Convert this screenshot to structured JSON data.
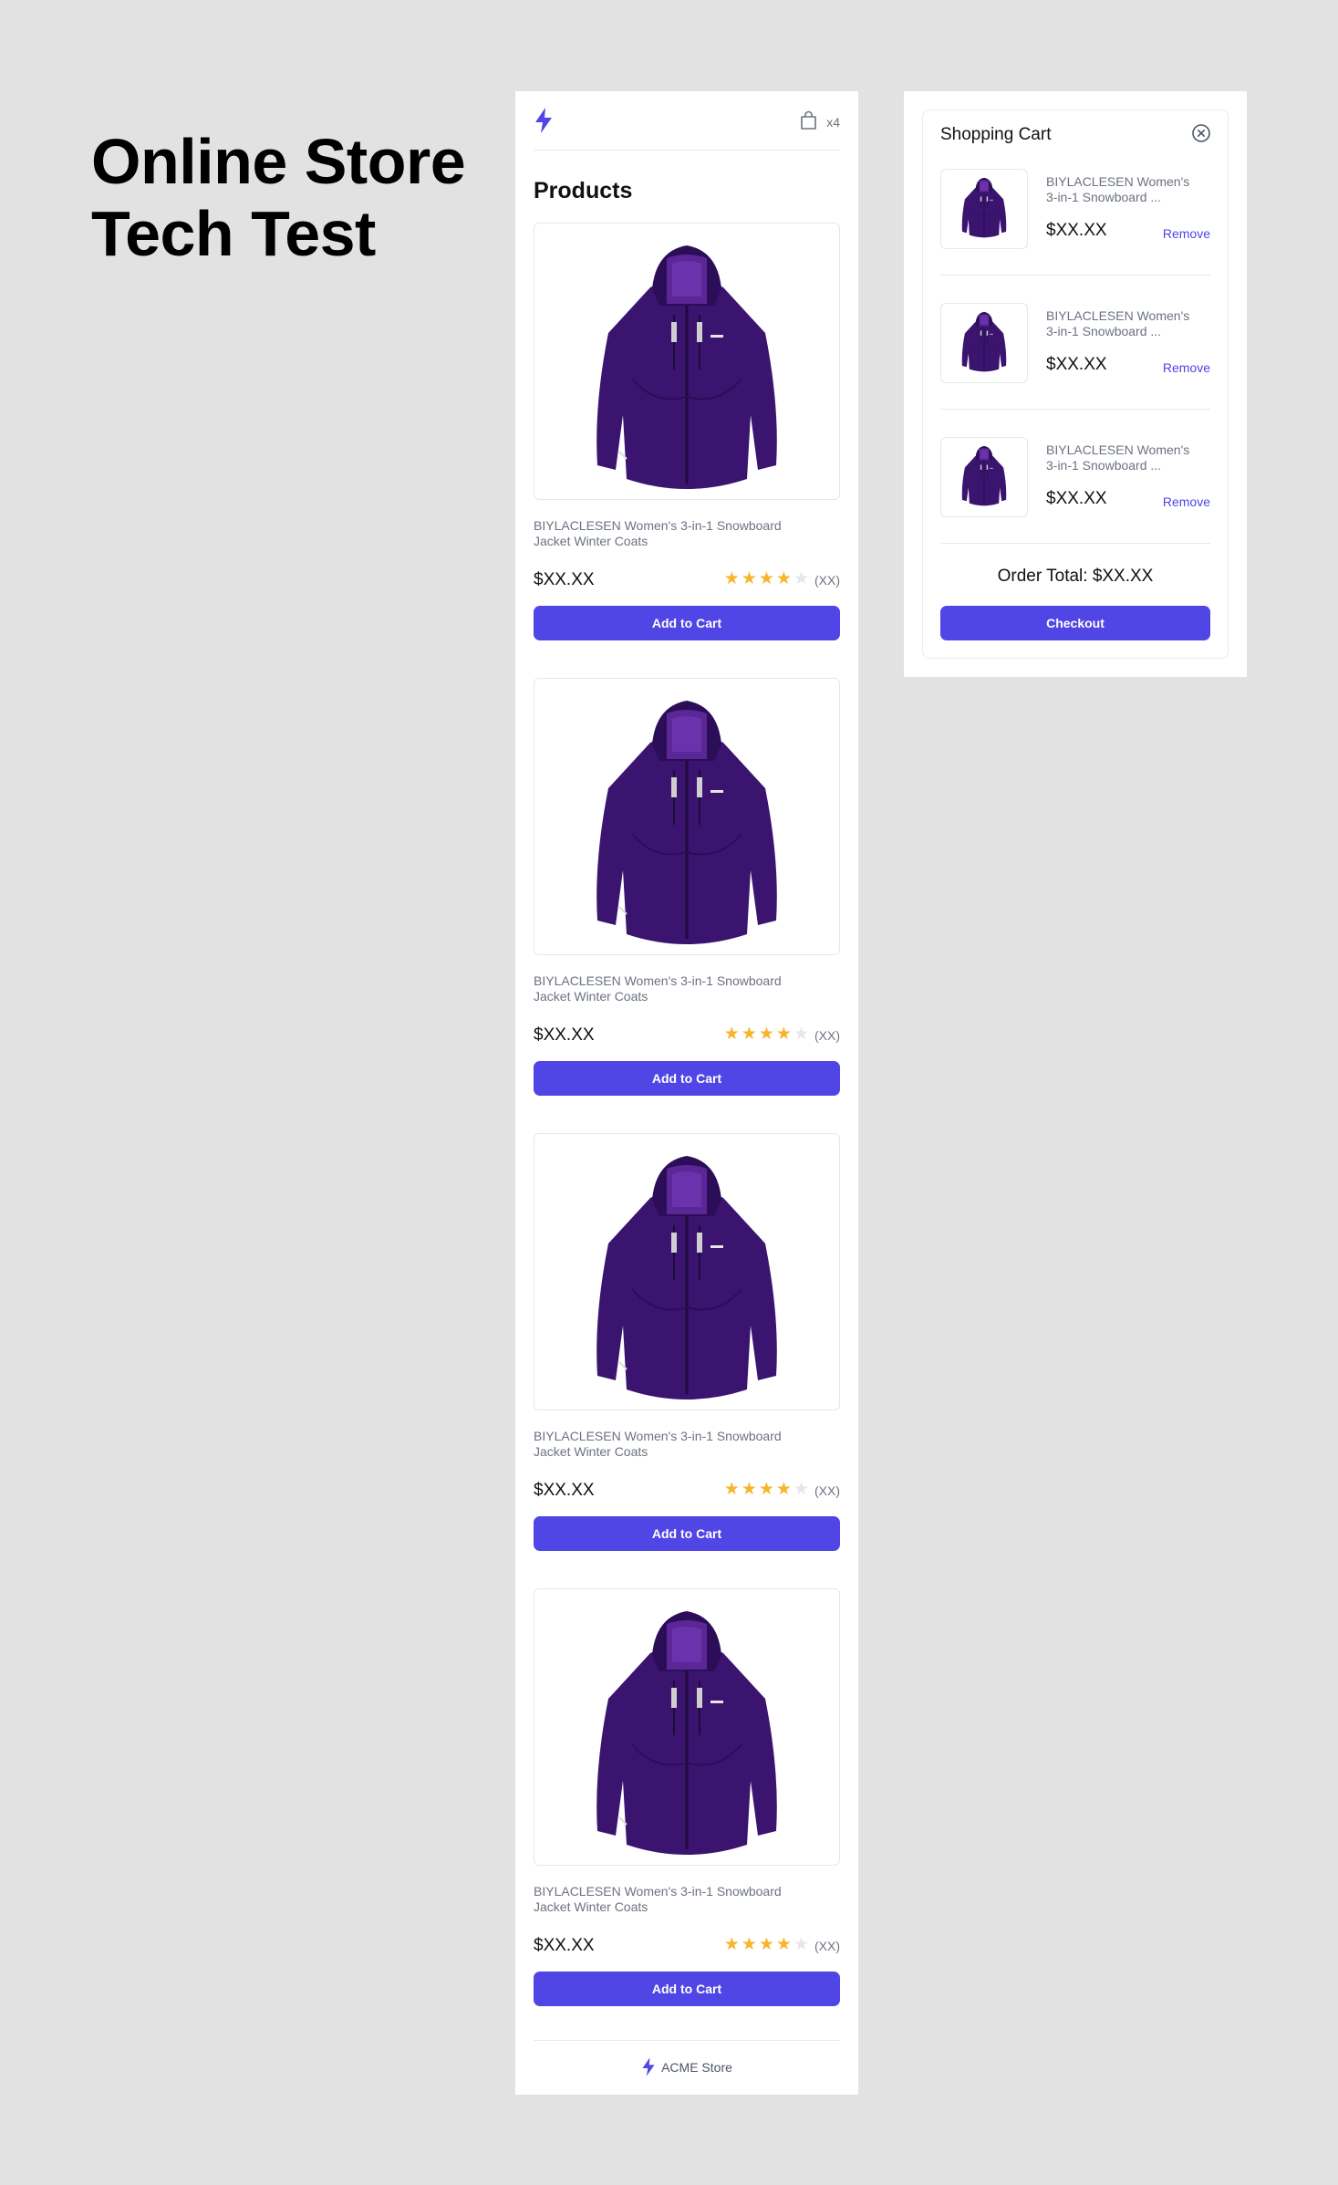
{
  "hero": {
    "line1": "Online Store",
    "line2": "Tech Test"
  },
  "header": {
    "logo_icon": "lightning-bolt-icon",
    "cart_icon": "shopping-bag-icon",
    "cart_count": "x4"
  },
  "products": {
    "title": "Products",
    "items": [
      {
        "name": "BIYLACLESEN Women's 3-in-1 Snowboard Jacket Winter Coats",
        "price": "$XX.XX",
        "rating": 4,
        "max_rating": 5,
        "reviews": "(XX)",
        "button": "Add to Cart"
      },
      {
        "name": "BIYLACLESEN Women's 3-in-1 Snowboard Jacket Winter Coats",
        "price": "$XX.XX",
        "rating": 4,
        "max_rating": 5,
        "reviews": "(XX)",
        "button": "Add to Cart"
      },
      {
        "name": "BIYLACLESEN Women's 3-in-1 Snowboard Jacket Winter Coats",
        "price": "$XX.XX",
        "rating": 4,
        "max_rating": 5,
        "reviews": "(XX)",
        "button": "Add to Cart"
      },
      {
        "name": "BIYLACLESEN Women's 3-in-1 Snowboard Jacket Winter Coats",
        "price": "$XX.XX",
        "rating": 4,
        "max_rating": 5,
        "reviews": "(XX)",
        "button": "Add to Cart"
      }
    ]
  },
  "footer": {
    "logo_icon": "lightning-bolt-icon",
    "label": "ACME Store"
  },
  "cart": {
    "title": "Shopping Cart",
    "close_icon": "close-circle-icon",
    "items": [
      {
        "name": "BIYLACLESEN Women's 3-in-1 Snowboard ...",
        "price": "$XX.XX",
        "remove": "Remove"
      },
      {
        "name": "BIYLACLESEN Women's 3-in-1 Snowboard ...",
        "price": "$XX.XX",
        "remove": "Remove"
      },
      {
        "name": "BIYLACLESEN Women's 3-in-1 Snowboard ...",
        "price": "$XX.XX",
        "remove": "Remove"
      }
    ],
    "order_total": "Order Total: $XX.XX",
    "checkout": "Checkout"
  },
  "colors": {
    "accent": "#4f46e5",
    "star": "#f6b52b",
    "background": "#e2e2e2",
    "jacket": "#3b1470"
  }
}
